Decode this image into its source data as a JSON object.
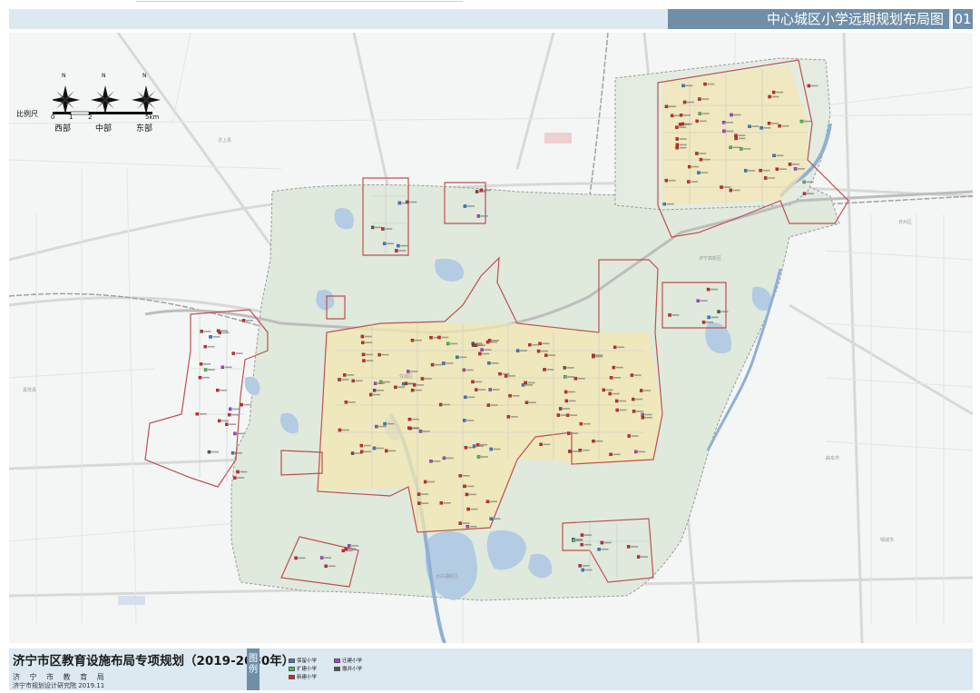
{
  "header": {
    "title": "中心城区小学远期规划布局图",
    "page_number": "01"
  },
  "compass": {
    "roses": [
      "西部",
      "中部",
      "东部"
    ],
    "north": "N",
    "scale_label": "比例尺",
    "scale_ticks": [
      "0",
      "1",
      "2",
      "5km"
    ]
  },
  "footer": {
    "project_title": "济宁市区教育设施布局专项规划（2019-2030年）",
    "org_bureau": "济 宁 市 教 育 局",
    "org_institute": "济宁市规划设计研究院 2019.11",
    "legend_tag": "图例",
    "legend_items": [
      {
        "label": "保留小学",
        "color": "#2f7fd6"
      },
      {
        "label": "迁建小学",
        "color": "#b23bd9"
      },
      {
        "label": "扩建小学",
        "color": "#46c24a"
      },
      {
        "label": "撤并小学",
        "color": "#555555"
      },
      {
        "label": "新建小学",
        "color": "#e02020"
      }
    ]
  },
  "colors": {
    "boundary": "#c0504d",
    "planning_area": "#dde8d8",
    "water": "#a8c4e0",
    "road": "#d9d9d9",
    "rail": "#9a9a9a",
    "highlight": "#f6e7a3"
  },
  "district_labels": [
    "嘉祥县",
    "汶上县",
    "济宁高新区",
    "太白湖新区",
    "任城区",
    "兖州区",
    "邹城市",
    "曲阜市"
  ]
}
